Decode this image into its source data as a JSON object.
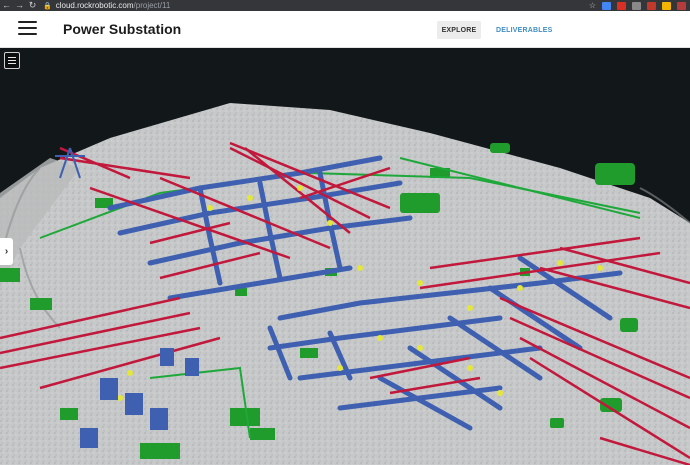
{
  "browser": {
    "url_host": "cloud.rockrobotic.com",
    "url_path": "/project/11",
    "back_icon": "arrow-left-icon",
    "forward_icon": "arrow-right-icon",
    "reload_icon": "reload-icon"
  },
  "header": {
    "menu_icon": "hamburger-icon",
    "title": "Power Substation",
    "tabs": [
      {
        "label": "EXPLORE",
        "active": true
      },
      {
        "label": "DELIVERABLES",
        "active": false
      }
    ]
  },
  "viewer": {
    "layers_icon": "layers-menu-icon",
    "expand_icon": "chevron-right-icon",
    "expand_label": "›",
    "colors": {
      "ground": "#c9cbcc",
      "vegetation": "#1f9c2b",
      "structure": "#3f5fb0",
      "conductor": "#c2183c",
      "insulator": "#e4e63a"
    }
  }
}
